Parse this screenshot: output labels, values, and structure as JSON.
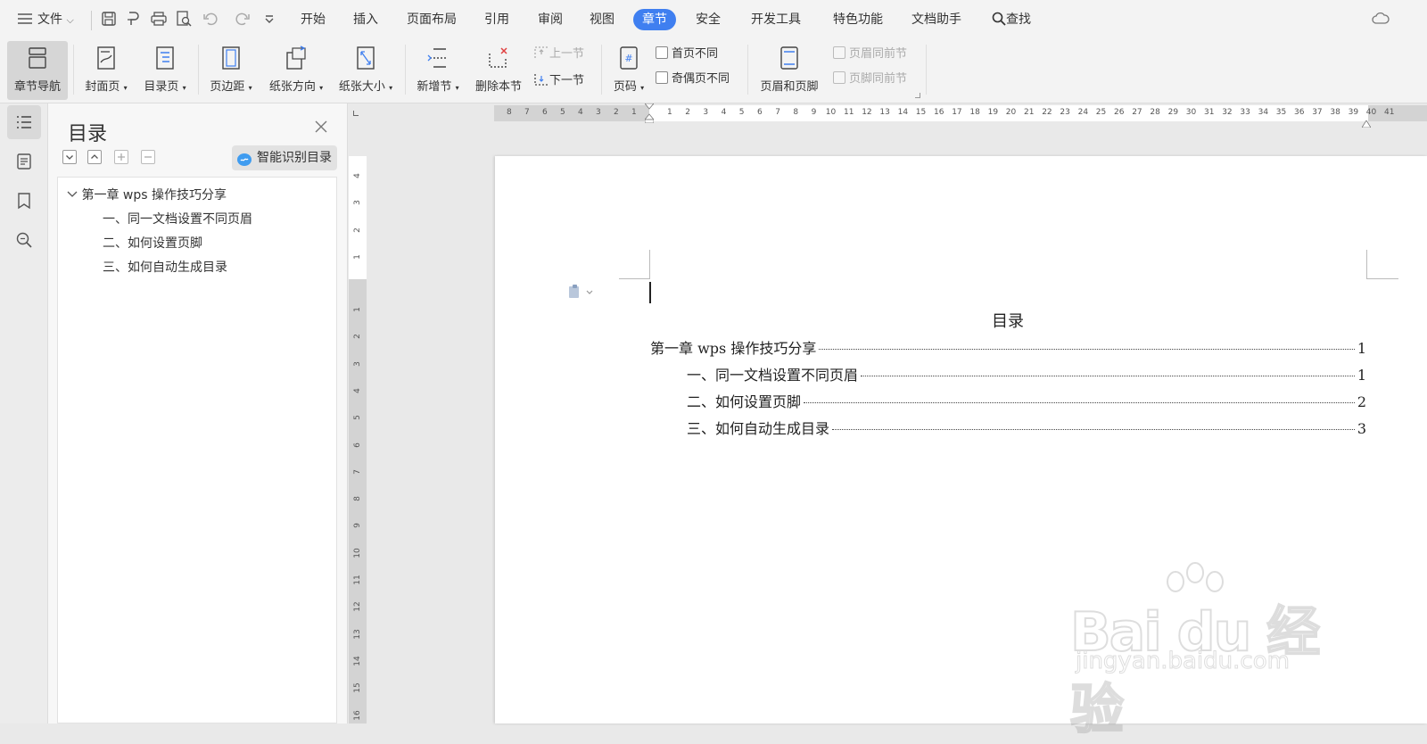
{
  "menubar": {
    "file_label": "文件",
    "items": [
      "开始",
      "插入",
      "页面布局",
      "引用",
      "审阅",
      "视图",
      "章节",
      "安全",
      "开发工具",
      "特色功能",
      "文档助手"
    ],
    "active_item": "章节",
    "search_label": "查找"
  },
  "ribbon": {
    "chapter_nav": "章节导航",
    "cover_page": "封面页",
    "toc_page": "目录页",
    "margins": "页边距",
    "orientation": "纸张方向",
    "paper_size": "纸张大小",
    "new_section": "新增节",
    "delete_section": "删除本节",
    "prev_section": "上一节",
    "next_section": "下一节",
    "page_number": "页码",
    "first_page_diff": "首页不同",
    "odd_even_diff": "奇偶页不同",
    "header_footer": "页眉和页脚",
    "header_same_prev": "页眉同前节",
    "footer_same_prev": "页脚同前节"
  },
  "toc_panel": {
    "title": "目录",
    "smart_button": "智能识别目录",
    "tree": [
      {
        "level": 1,
        "text": "第一章 wps 操作技巧分享"
      },
      {
        "level": 2,
        "text": "一、同一文档设置不同页眉"
      },
      {
        "level": 2,
        "text": "二、如何设置页脚"
      },
      {
        "level": 2,
        "text": "三、如何自动生成目录"
      }
    ]
  },
  "ruler": {
    "h_left": [
      "8",
      "7",
      "6",
      "5",
      "4",
      "3",
      "2",
      "1"
    ],
    "h_right": [
      "1",
      "2",
      "3",
      "4",
      "5",
      "6",
      "7",
      "8",
      "9",
      "10",
      "11",
      "12",
      "13",
      "14",
      "15",
      "16",
      "17",
      "18",
      "19",
      "20",
      "21",
      "22",
      "23",
      "24",
      "25",
      "26",
      "27",
      "28",
      "29",
      "30",
      "31",
      "32",
      "33",
      "34",
      "35",
      "36",
      "37",
      "38",
      "39",
      "40",
      "41"
    ],
    "v_top": [
      "4",
      "3",
      "2",
      "1"
    ],
    "v_bottom": [
      "1",
      "2",
      "3",
      "4",
      "5",
      "6",
      "7",
      "8",
      "9",
      "10",
      "11",
      "12",
      "13",
      "14",
      "15",
      "16"
    ]
  },
  "document": {
    "toc_title": "目录",
    "entries": [
      {
        "text": "第一章 wps 操作技巧分享",
        "page": "1",
        "indent": 0
      },
      {
        "text": "一、同一文档设置不同页眉",
        "page": "1",
        "indent": 1
      },
      {
        "text": "二、如何设置页脚",
        "page": "2",
        "indent": 1
      },
      {
        "text": "三、如何自动生成目录",
        "page": "3",
        "indent": 1
      }
    ]
  },
  "watermark": {
    "brand": "Bai du 经验",
    "url": "jingyan.baidu.com"
  },
  "colors": {
    "accent": "#3f7ff0",
    "background": "#e9e9e9",
    "page": "#ffffff"
  }
}
